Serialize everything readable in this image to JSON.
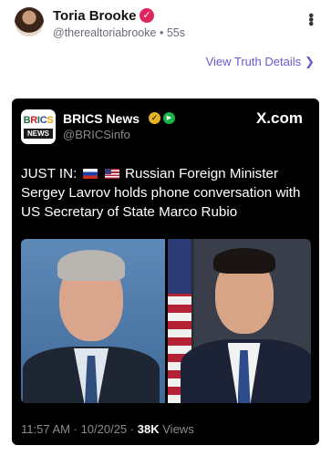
{
  "post": {
    "display_name": "Toria Brooke",
    "handle": "@therealtoriabrooke",
    "separator": "•",
    "time_ago": "55s",
    "more_icon": "more-dots-icon",
    "view_details_label": "View Truth Details",
    "view_details_icon": "chevron-right-icon",
    "accent_color": "#6a5acd",
    "badge_color": "#e0245e"
  },
  "embed": {
    "account_name": "BRICS News",
    "account_handle": "@BRICSinfo",
    "logo_text_top": [
      "B",
      "R",
      "I",
      "C",
      "S"
    ],
    "logo_text_bottom": "NEWS",
    "source_logo": "X.com",
    "text_lead": "JUST IN:",
    "text_body": "Russian Foreign Minister Sergey Lavrov holds phone conversation with US Secretary of State Marco Rubio",
    "flags": [
      "russia-flag-icon",
      "usa-flag-icon"
    ],
    "photo_left": "Sergey Lavrov portrait",
    "photo_right": "Marco Rubio portrait",
    "time": "11:57 AM",
    "date": "10/20/25",
    "meta_separator": "·",
    "views_count": "38K",
    "views_label": "Views"
  }
}
